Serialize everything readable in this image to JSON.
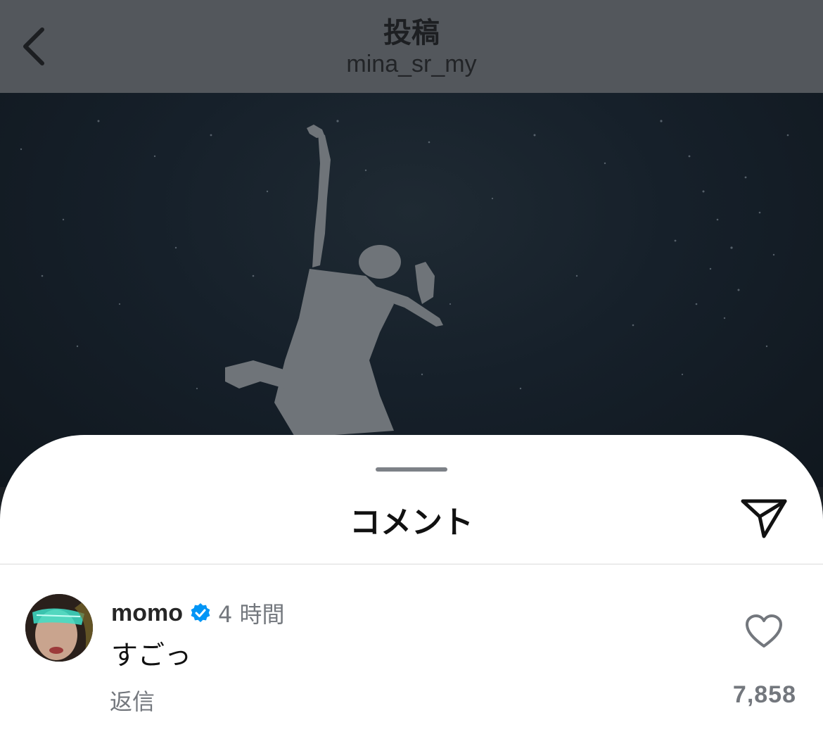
{
  "header": {
    "title": "投稿",
    "subtitle": "mina_sr_my"
  },
  "photo": {
    "description_icon": "post-photo"
  },
  "sheet": {
    "title": "コメント"
  },
  "comment": {
    "username": "momo",
    "verified": true,
    "time": "4 時間",
    "text": "すごっ",
    "reply_label": "返信",
    "like_count": "7,858"
  },
  "colors": {
    "overlay_header": "#53575c",
    "verified_blue": "#0095f6",
    "secondary_text": "#73777d"
  }
}
